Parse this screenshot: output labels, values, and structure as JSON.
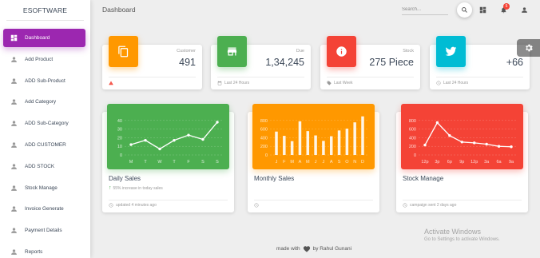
{
  "sidebar": {
    "brand": "ESOFTWARE",
    "items": [
      {
        "label": "Dashboard",
        "icon": "dashboard-icon",
        "active": true
      },
      {
        "label": "Add Product",
        "icon": "person-icon"
      },
      {
        "label": "ADD Sub-Product",
        "icon": "person-icon"
      },
      {
        "label": "Add Category",
        "icon": "person-icon"
      },
      {
        "label": "ADD Sub-Category",
        "icon": "person-icon"
      },
      {
        "label": "ADD CUSTOMER",
        "icon": "person-icon"
      },
      {
        "label": "ADD STOCK",
        "icon": "person-icon"
      },
      {
        "label": "Stock Manage",
        "icon": "person-icon"
      },
      {
        "label": "Invoice Generate",
        "icon": "person-icon"
      },
      {
        "label": "Payment Details",
        "icon": "person-icon"
      },
      {
        "label": "Reports",
        "icon": "person-icon"
      }
    ],
    "active_color": "#9c27b0"
  },
  "header": {
    "title": "Dashboard",
    "search_placeholder": "Search...",
    "notification_count": "5"
  },
  "stats": [
    {
      "label": "Customer",
      "value": "491",
      "footer": "",
      "icon": "copy-icon",
      "footer_icon": "warning-icon",
      "color": "#ff9800"
    },
    {
      "label": "Due",
      "value": "1,34,245",
      "footer": "Last 24 Hours",
      "icon": "store-icon",
      "footer_icon": "calendar-icon",
      "color": "#4caf50"
    },
    {
      "label": "Stock",
      "value": "275 Piece",
      "footer": "Last Week",
      "icon": "info-icon",
      "footer_icon": "tag-icon",
      "color": "#f44336"
    },
    {
      "label": "",
      "value": "+66",
      "footer": "Last 24 Hours",
      "icon": "twitter-icon",
      "footer_icon": "update-icon",
      "color": "#00bcd4"
    }
  ],
  "charts": [
    {
      "title": "Daily Sales",
      "sub_arrow": "↑",
      "sub_text": "55% increase in today sales",
      "footer": "updated 4 minutes ago",
      "color": "#4caf50"
    },
    {
      "title": "Monthly Sales",
      "sub_arrow": "",
      "sub_text": "",
      "footer": "",
      "color": "#ff9800"
    },
    {
      "title": "Stock Manage",
      "sub_arrow": "",
      "sub_text": "",
      "footer": "campaign sent 2 days ago",
      "color": "#f44336"
    }
  ],
  "chart_data": [
    {
      "type": "line",
      "categories": [
        "M",
        "T",
        "W",
        "T",
        "F",
        "S",
        "S"
      ],
      "values": [
        12,
        17,
        7,
        17,
        23,
        18,
        38
      ],
      "ylim": [
        0,
        50
      ],
      "yticks": [
        0,
        10,
        20,
        30,
        40
      ],
      "grid": true
    },
    {
      "type": "bar",
      "categories": [
        "J",
        "F",
        "M",
        "A",
        "M",
        "J",
        "J",
        "A",
        "S",
        "O",
        "N",
        "D"
      ],
      "values": [
        542,
        443,
        320,
        780,
        553,
        453,
        326,
        434,
        568,
        610,
        756,
        895
      ],
      "ylim": [
        0,
        1000
      ],
      "yticks": [
        0,
        200,
        400,
        600,
        800
      ],
      "grid": true
    },
    {
      "type": "line",
      "categories": [
        "12p",
        "3p",
        "6p",
        "9p",
        "12p",
        "3a",
        "6a",
        "9a"
      ],
      "values": [
        230,
        750,
        450,
        300,
        280,
        250,
        200,
        190
      ],
      "ylim": [
        0,
        1000
      ],
      "yticks": [
        0,
        200,
        400,
        600,
        800
      ],
      "grid": true
    }
  ],
  "footer": {
    "prefix": "made with",
    "suffix": "by Rahul Gunani"
  },
  "watermark": {
    "title": "Activate Windows",
    "sub": "Go to Settings to activate Windows."
  }
}
